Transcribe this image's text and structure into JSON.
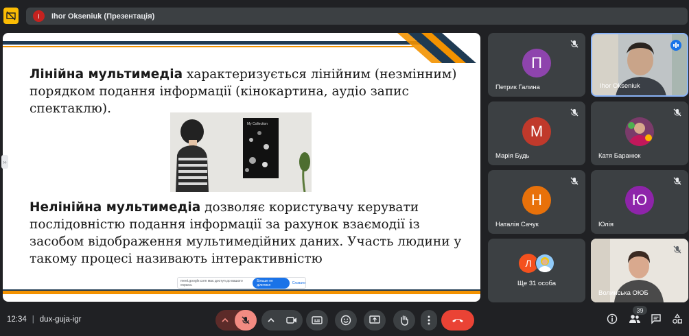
{
  "presentation": {
    "avatar_letter": "I",
    "title": "Ihor Okseniuk (Презентація)"
  },
  "slide": {
    "p1_bold": "Лінійна мультимедіа",
    "p1_rest": " характеризується лінійним (незмінним) порядком подання інформації (кінокартина, аудіо запис спектаклю).",
    "photo_caption": "My Collection",
    "p2_bold": "Нелінійна мультимедіа",
    "p2_rest": " дозволяє користувачу керувати послідовністю подання інформації за рахунок взаємодії із засобом відображення мультимедійних даних.  Участь людини у такому процесі називають інтерактивністю",
    "share_text": "meet.google.com має доступ до вашого екрана.",
    "share_stop": "Більше не ділитися",
    "share_hide": "Сховати",
    "colors": {
      "navy": "#1f3a52",
      "orange": "#f39200"
    }
  },
  "participants": [
    {
      "name": "Петрик Галина",
      "letter": "П",
      "color": "#8e44ad"
    },
    {
      "name": "Ihor Okseniuk",
      "letter": "",
      "color": ""
    },
    {
      "name": "Марія Будь",
      "letter": "М",
      "color": "#c0392b"
    },
    {
      "name": "Катя Баранюк",
      "letter": "",
      "color": ""
    },
    {
      "name": "Наталія Сачук",
      "letter": "Н",
      "color": "#e8710a"
    },
    {
      "name": "Юлія",
      "letter": "Ю",
      "color": "#8e24aa"
    },
    {
      "name": "Ще 31 особа",
      "letter": "Л",
      "color": "#f4511e"
    },
    {
      "name": "Волинська ОЮБ",
      "letter": "",
      "color": ""
    }
  ],
  "bottom": {
    "time": "12:34",
    "separator": "|",
    "meeting_code": "dux-guja-igr",
    "people_count": "39"
  },
  "icons": {
    "warning": "warning-icon",
    "mic_off": "mic-off-icon",
    "camera": "camera-icon",
    "captions": "captions-icon",
    "emoji": "emoji-icon",
    "present": "present-icon",
    "hand": "raise-hand-icon",
    "more": "more-icon",
    "end_call": "end-call-icon",
    "info": "info-icon",
    "people": "people-icon",
    "chat": "chat-icon",
    "activities": "activities-icon"
  }
}
